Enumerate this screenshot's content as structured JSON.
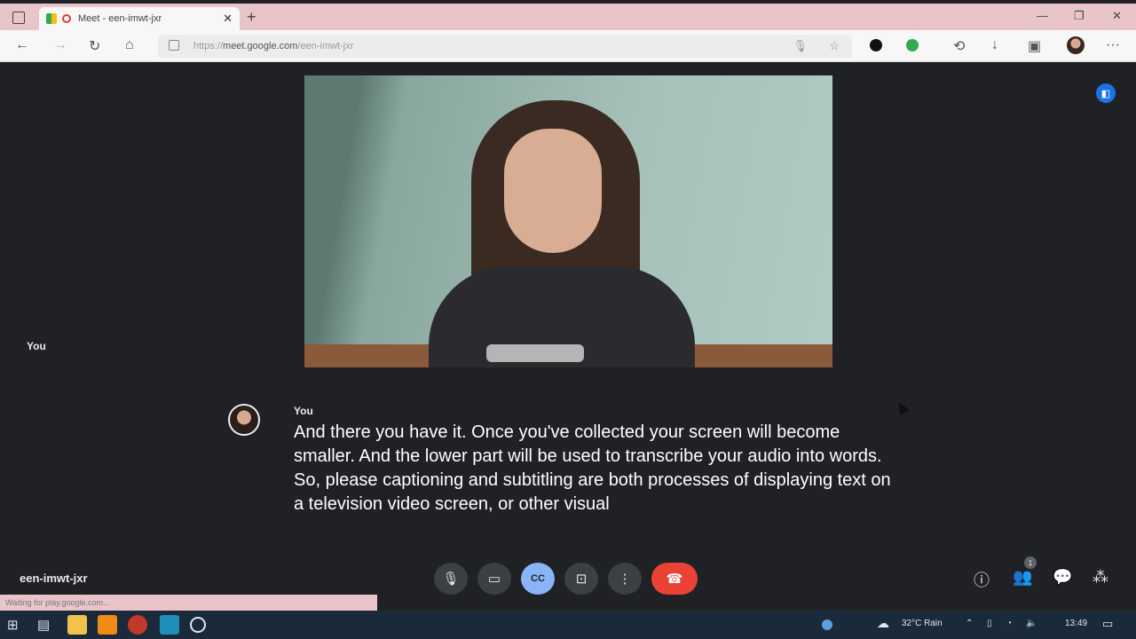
{
  "browser": {
    "tab_title": "Meet - een-imwt-jxr",
    "tab_close": "✕",
    "new_tab": "+",
    "url_prefix": "https://",
    "url_host": "meet.google.com",
    "url_path": "/een-imwt-jxr",
    "minimize": "—",
    "restore": "❐",
    "close": "✕",
    "more": "···"
  },
  "meet": {
    "self_tile_label": "You",
    "caption": {
      "speaker": "You",
      "text": "And there you have it. Once you've collected your screen will become smaller. And the lower part will be used to transcribe your audio into words. So, please captioning and subtitling are both processes of displaying text on a television video screen, or other visual"
    },
    "meeting_code": "een-imwt-jxr",
    "participants_count": "1",
    "controls": [
      "mic",
      "camera",
      "captions",
      "present",
      "more",
      "leave-call"
    ],
    "captions_active": true
  },
  "status_text": "Waiting for play.google.com...",
  "taskbar": {
    "weather": "32°C  Rain",
    "time": "13:49"
  },
  "colors": {
    "meet_bg": "#202124",
    "end_call": "#ea4335",
    "captions_active": "#8ab4f8",
    "accent": "#1a73e8"
  }
}
